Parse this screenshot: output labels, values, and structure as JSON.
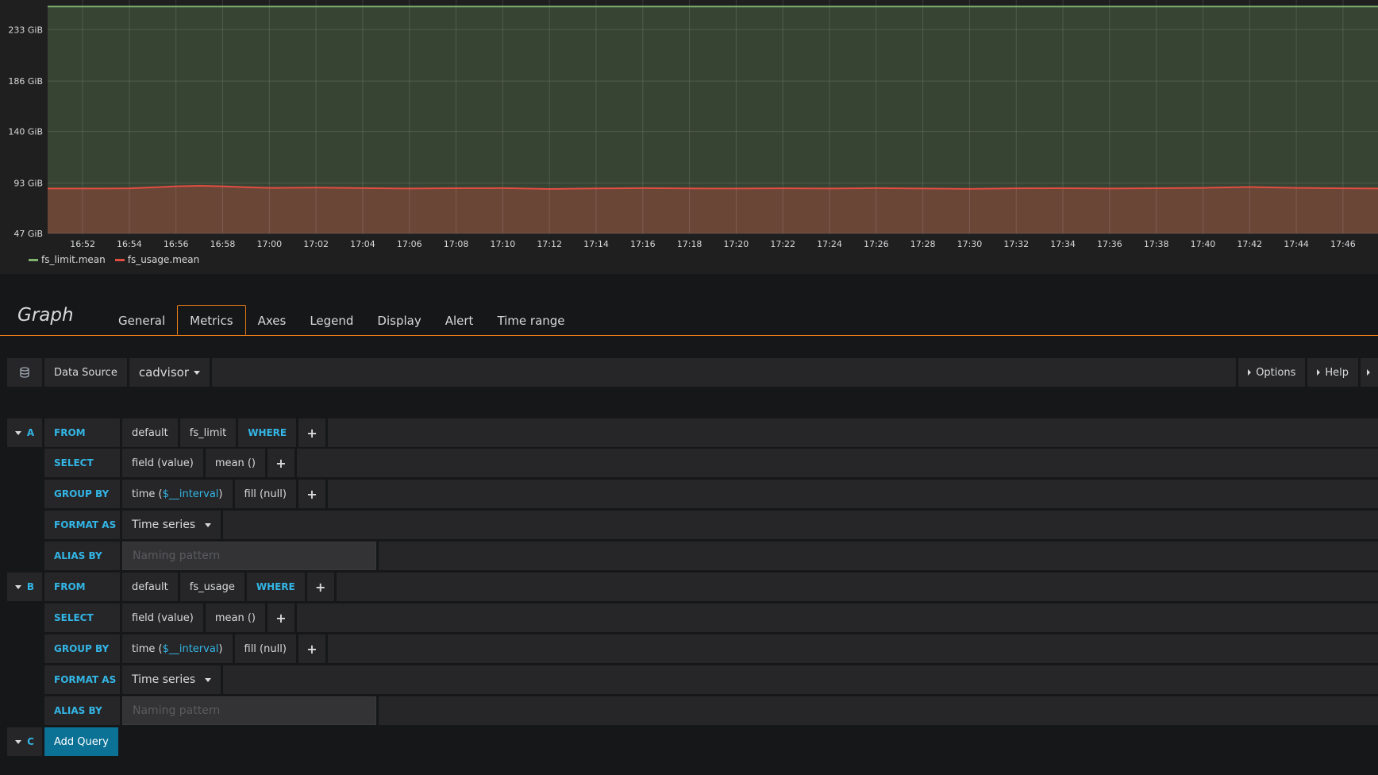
{
  "chart_data": {
    "type": "area",
    "y_ticks": [
      "47 GiB",
      "93 GiB",
      "140 GiB",
      "186 GiB",
      "233 GiB"
    ],
    "y_tick_values": [
      47,
      93,
      140,
      186,
      233
    ],
    "ylim": [
      47,
      260
    ],
    "x_ticks": [
      "16:52",
      "16:54",
      "16:56",
      "16:58",
      "17:00",
      "17:02",
      "17:04",
      "17:06",
      "17:08",
      "17:10",
      "17:12",
      "17:14",
      "17:16",
      "17:18",
      "17:20",
      "17:22",
      "17:24",
      "17:26",
      "17:28",
      "17:30",
      "17:32",
      "17:34",
      "17:36",
      "17:38",
      "17:40",
      "17:42",
      "17:44",
      "17:46"
    ],
    "x_range": [
      "16:50.5",
      "17:47.5"
    ],
    "grid": true,
    "legend_position": "bottom-left",
    "series": [
      {
        "name": "fs_limit.mean",
        "color": "#7eb26d",
        "points": [
          [
            "16:50.5",
            254
          ],
          [
            "17:47.5",
            254
          ]
        ]
      },
      {
        "name": "fs_usage.mean",
        "color": "#e24d42",
        "points": [
          [
            "16:50.5",
            88
          ],
          [
            "16:53",
            88
          ],
          [
            "16:54",
            88.2
          ],
          [
            "16:55",
            89
          ],
          [
            "16:56",
            90
          ],
          [
            "16:57",
            90.5
          ],
          [
            "16:58",
            90
          ],
          [
            "16:59",
            89.2
          ],
          [
            "17:00",
            88.6
          ],
          [
            "17:02",
            88.8
          ],
          [
            "17:04",
            88.4
          ],
          [
            "17:06",
            88
          ],
          [
            "17:08",
            88.3
          ],
          [
            "17:10",
            88.4
          ],
          [
            "17:12",
            87.6
          ],
          [
            "17:14",
            88.1
          ],
          [
            "17:16",
            88.4
          ],
          [
            "17:18",
            88.1
          ],
          [
            "17:20",
            88
          ],
          [
            "17:22",
            88.2
          ],
          [
            "17:24",
            88
          ],
          [
            "17:26",
            88.4
          ],
          [
            "17:28",
            88
          ],
          [
            "17:30",
            87.7
          ],
          [
            "17:32",
            88.2
          ],
          [
            "17:34",
            88.3
          ],
          [
            "17:36",
            88
          ],
          [
            "17:38",
            88.3
          ],
          [
            "17:40",
            88.6
          ],
          [
            "17:42",
            89.4
          ],
          [
            "17:44",
            88.6
          ],
          [
            "17:46",
            88.2
          ],
          [
            "17:47.5",
            88
          ]
        ]
      }
    ]
  },
  "editor": {
    "title": "Graph",
    "tabs": [
      "General",
      "Metrics",
      "Axes",
      "Legend",
      "Display",
      "Alert",
      "Time range"
    ],
    "active_tab": "Metrics"
  },
  "datasource": {
    "label": "Data Source",
    "value": "cadvisor",
    "options_label": "Options",
    "help_label": "Help"
  },
  "queries": [
    {
      "letter": "A",
      "from_kw": "FROM",
      "policy": "default",
      "measurement": "fs_limit",
      "where_kw": "WHERE",
      "select_kw": "SELECT",
      "field": "field (value)",
      "agg": "mean ()",
      "group_kw": "GROUP BY",
      "time_prefix": "time (",
      "interval": "$__interval",
      "time_suffix": ")",
      "fill": "fill (null)",
      "format_kw": "FORMAT AS",
      "format": "Time series",
      "alias_kw": "ALIAS BY",
      "alias_placeholder": "Naming pattern"
    },
    {
      "letter": "B",
      "from_kw": "FROM",
      "policy": "default",
      "measurement": "fs_usage",
      "where_kw": "WHERE",
      "select_kw": "SELECT",
      "field": "field (value)",
      "agg": "mean ()",
      "group_kw": "GROUP BY",
      "time_prefix": "time (",
      "interval": "$__interval",
      "time_suffix": ")",
      "fill": "fill (null)",
      "format_kw": "FORMAT AS",
      "format": "Time series",
      "alias_kw": "ALIAS BY",
      "alias_placeholder": "Naming pattern"
    }
  ],
  "add_query": {
    "letter": "C",
    "label": "Add Query"
  },
  "icons": {
    "datasource": "database-icon",
    "plus": "plus-icon"
  }
}
